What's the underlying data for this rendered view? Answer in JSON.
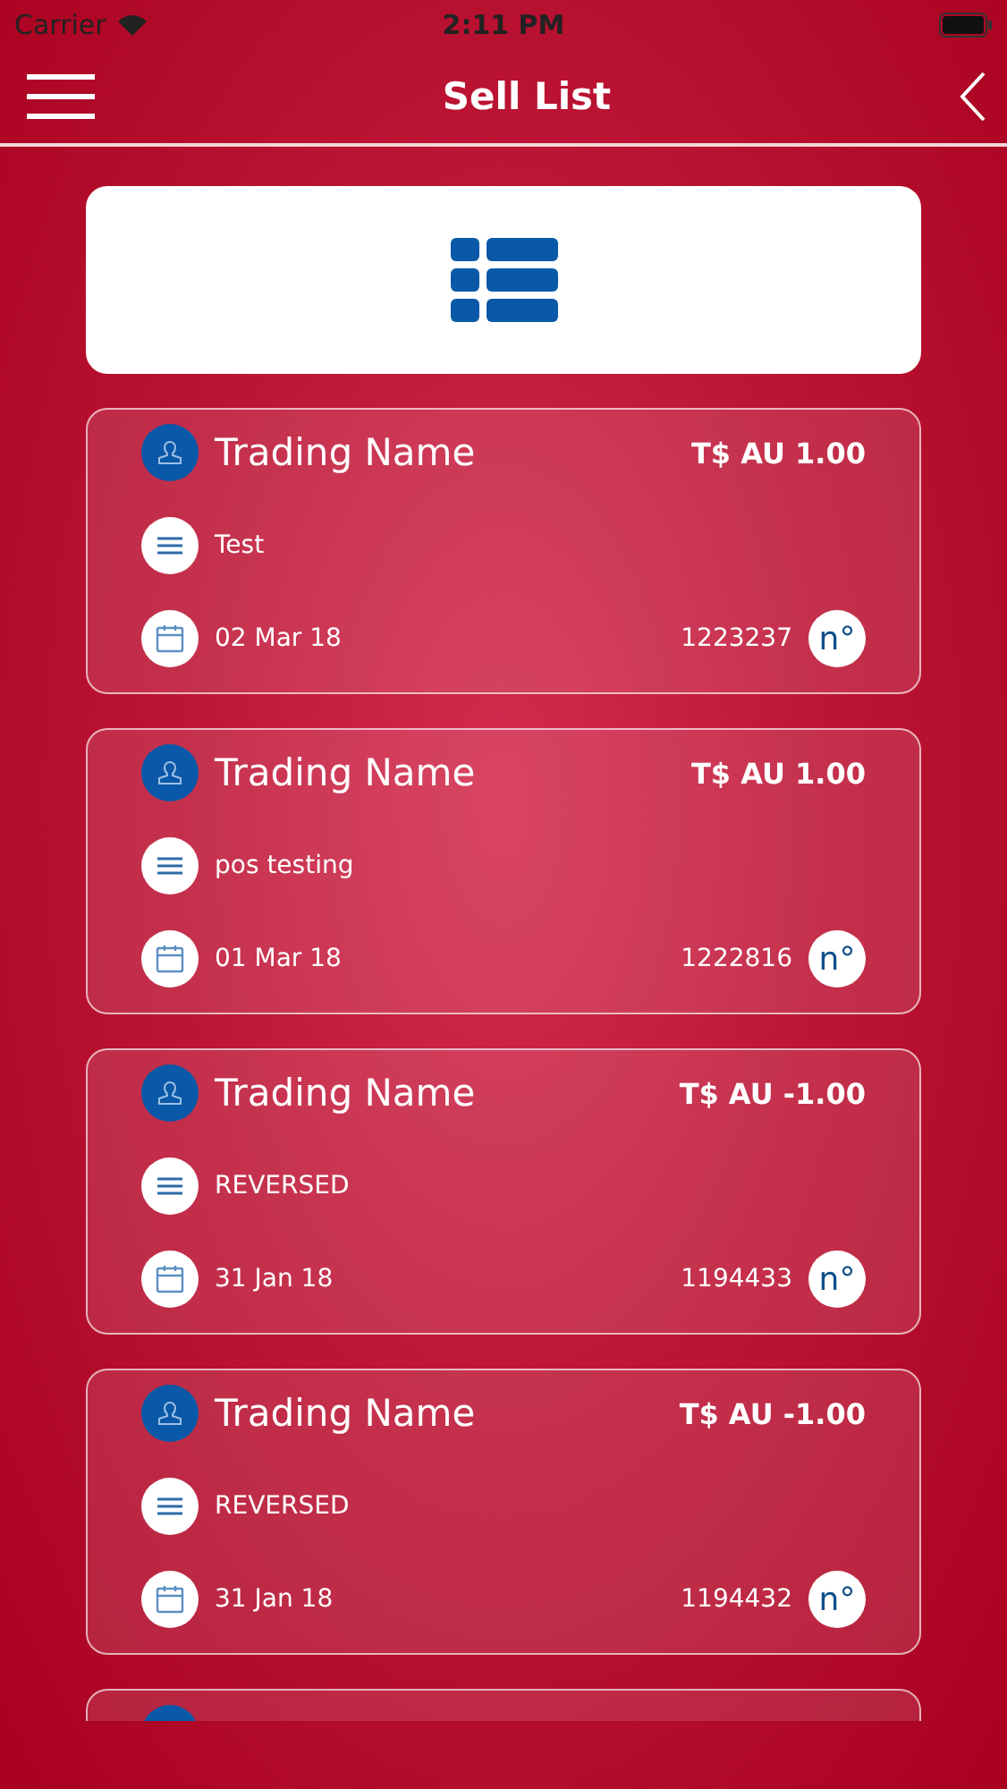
{
  "status_bar": {
    "carrier": "Carrier",
    "time": "2:11 PM"
  },
  "nav": {
    "title": "Sell List"
  },
  "sales": [
    {
      "kind": "full",
      "trader": "Trading Name",
      "amount": "T$ AU 1.00",
      "note": "Test",
      "date": "02 Mar 18",
      "number": "1223237",
      "number_badge": "n°"
    },
    {
      "kind": "full",
      "trader": "Trading Name",
      "amount": "T$ AU 1.00",
      "note": "pos testing",
      "date": "01 Mar 18",
      "number": "1222816",
      "number_badge": "n°"
    },
    {
      "kind": "full",
      "trader": "Trading Name",
      "amount": "T$ AU -1.00",
      "note": "REVERSED",
      "date": "31 Jan 18",
      "number": "1194433",
      "number_badge": "n°"
    },
    {
      "kind": "full",
      "trader": "Trading Name",
      "amount": "T$ AU -1.00",
      "note": "REVERSED",
      "date": "31 Jan 18",
      "number": "1194432",
      "number_badge": "n°"
    },
    {
      "kind": "clipped"
    }
  ]
}
